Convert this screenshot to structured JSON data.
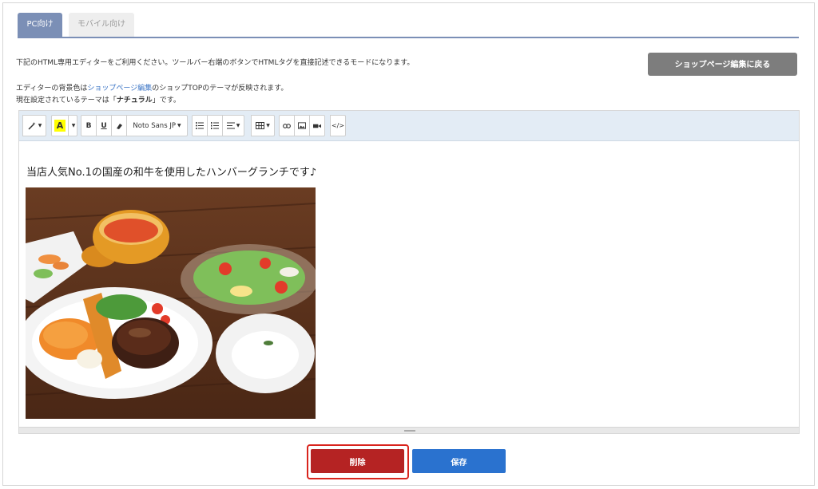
{
  "tabs": [
    {
      "label": "PC向け",
      "active": true
    },
    {
      "label": "モバイル向け",
      "active": false
    }
  ],
  "info": {
    "line1": "下記のHTML専用エディターをご利用ください。ツールバー右端のボタンでHTMLタグを直接記述できるモードになります。",
    "line2_prefix": "エディターの背景色は",
    "line2_link": "ショップページ編集",
    "line2_suffix": "のショップTOPのテーマが反映されます。",
    "line3_prefix": "現在設定されているテーマは「",
    "line3_theme": "ナチュラル",
    "line3_suffix": "」です。"
  },
  "back_button": "ショップページ編集に戻る",
  "toolbar": {
    "font_name": "Noto Sans JP",
    "highlight_letter": "A",
    "bold": "B",
    "underline": "U",
    "code_view": "</>"
  },
  "content": {
    "lead_text": "当店人気No.1の国産の和牛を使用したハンバーグランチです♪"
  },
  "actions": {
    "delete": "削除",
    "save": "保存"
  },
  "colors": {
    "tab_active": "#7b8fb6",
    "toolbar_bg": "#e3ecf5",
    "back_button": "#7d7d7d",
    "delete_button": "#b52323",
    "delete_outline": "#d9241c",
    "save_button": "#2a72cf"
  }
}
